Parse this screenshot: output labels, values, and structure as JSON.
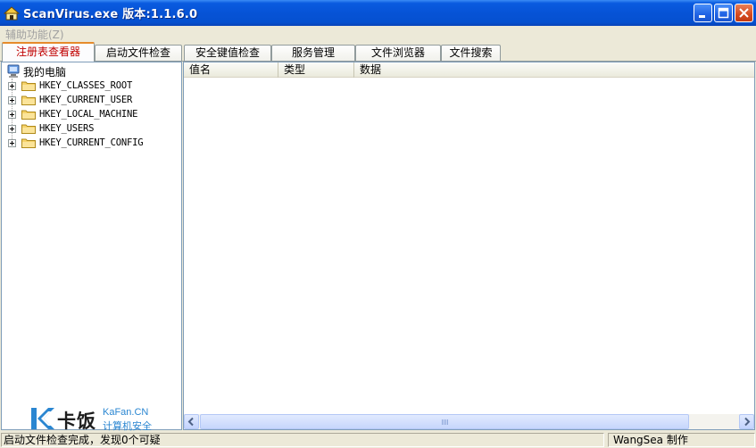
{
  "window": {
    "title": "ScanVirus.exe 版本:1.1.6.0"
  },
  "menu": {
    "items": [
      {
        "label": "辅助功能(Z)"
      }
    ]
  },
  "tabs": [
    {
      "label": "注册表查看器",
      "active": true
    },
    {
      "label": "启动文件检查"
    },
    {
      "label": "安全键值检查"
    },
    {
      "label": "服务管理"
    },
    {
      "label": "文件浏览器"
    },
    {
      "label": "文件搜索"
    }
  ],
  "tree": {
    "root": "我的电脑",
    "items": [
      "HKEY_CLASSES_ROOT",
      "HKEY_CURRENT_USER",
      "HKEY_LOCAL_MACHINE",
      "HKEY_USERS",
      "HKEY_CURRENT_CONFIG"
    ]
  },
  "list": {
    "columns": [
      "值名",
      "类型",
      "数据"
    ]
  },
  "watermark": {
    "cn": "卡饭",
    "en": "KaFan.CN",
    "sub": "计算机安全"
  },
  "status": {
    "message": "启动文件检查完成，发现0个可疑",
    "author": "WangSea 制作"
  },
  "colors": {
    "titlebar": "#0653d6",
    "active_tab_text": "#c00000",
    "active_tab_top": "#e68b2c",
    "watermark_blue": "#2a86d1"
  }
}
